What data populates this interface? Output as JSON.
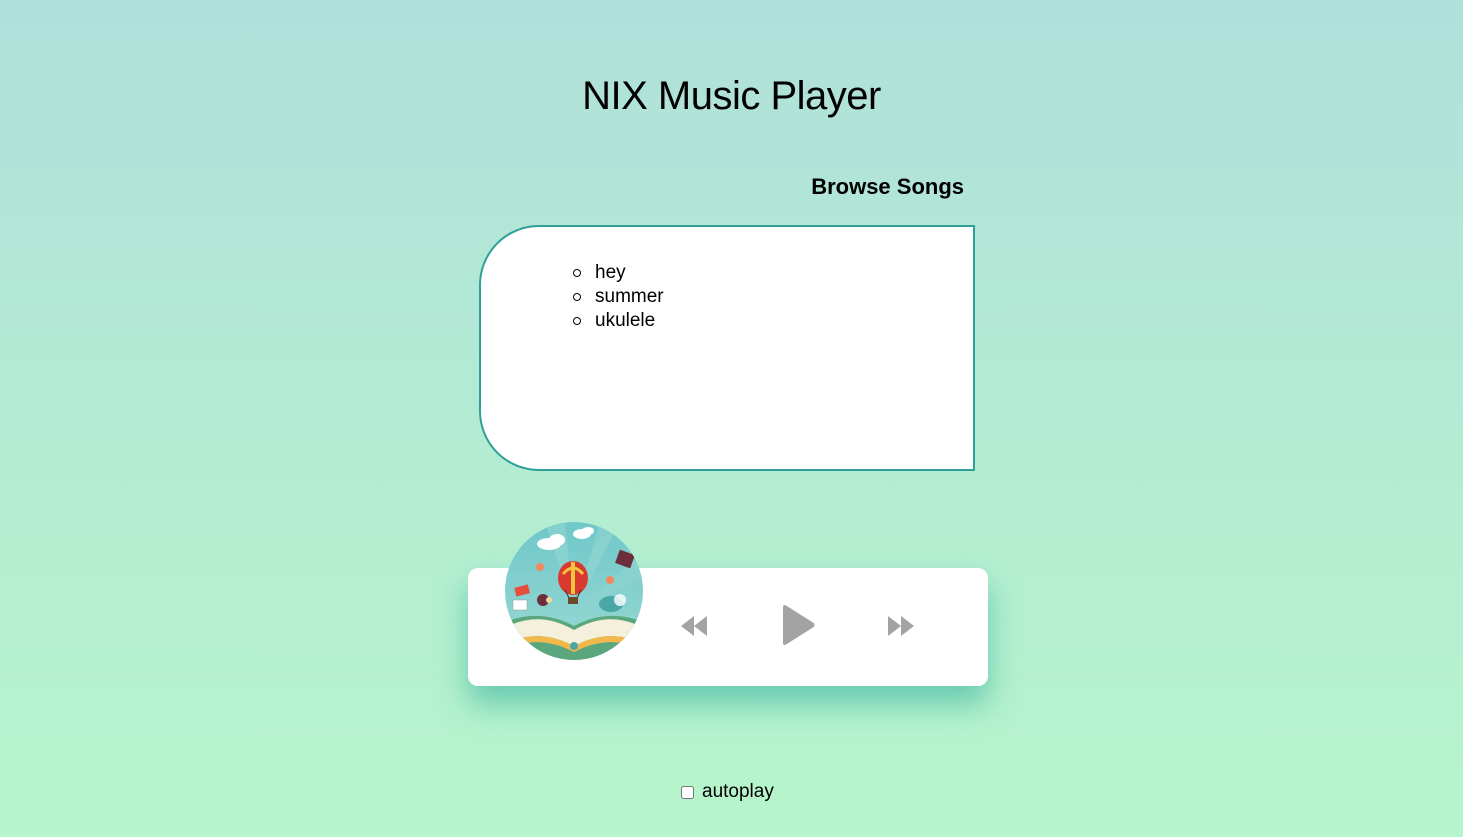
{
  "header": {
    "title": "NIX Music Player"
  },
  "browse": {
    "heading": "Browse Songs",
    "songs": [
      "hey",
      "summer",
      "ukulele"
    ]
  },
  "player": {
    "album_art_icon": "album-art-hot-air-balloon-book",
    "controls": {
      "rewind_icon": "rewind-icon",
      "play_icon": "play-icon",
      "forward_icon": "fast-forward-icon"
    }
  },
  "autoplay": {
    "label": "autoplay",
    "checked": false
  },
  "colors": {
    "accent_border": "#2f9f97",
    "control_gray": "#a3a3a3",
    "shadow_teal": "#28aa96"
  }
}
